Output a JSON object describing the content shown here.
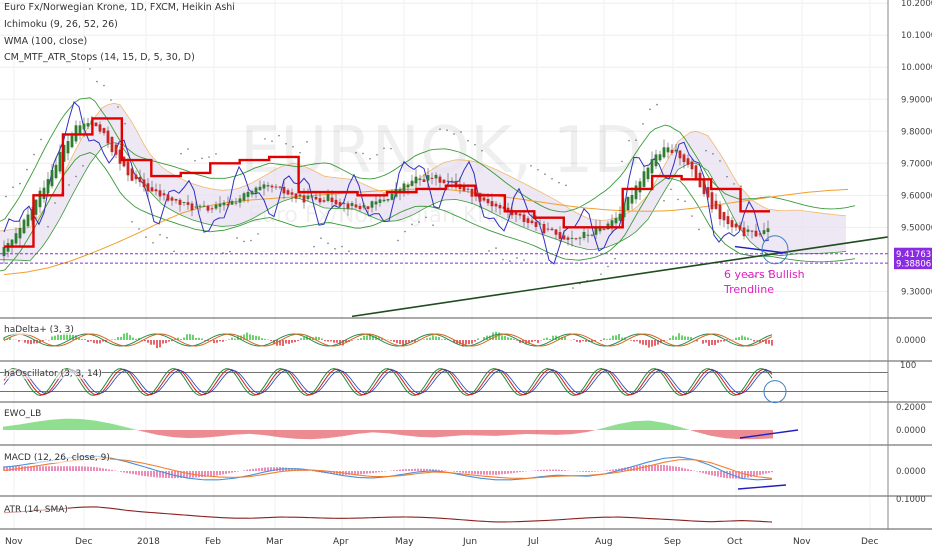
{
  "header": {
    "title": "Euro Fx/Norwegian Krone, 1D, FXCM, Heikin Ashi",
    "ichimoku": "Ichimoku (9, 26, 52, 26)",
    "wma": "WMA (100, close)",
    "atr_stops": "CM_MTF_ATR_Stops (14, 15, D, 5, 30, D)"
  },
  "watermark": {
    "symbol": "EURNOK, 1D",
    "subtitle": "Euro Fx/Norwegian Krone"
  },
  "annotation": {
    "line1": "6 years Bullish",
    "line2": "Trendline"
  },
  "x_axis": {
    "labels": [
      "Nov",
      "Dec",
      "2018",
      "Feb",
      "Mar",
      "Apr",
      "May",
      "Jun",
      "Jul",
      "Aug",
      "Sep",
      "Oct",
      "Nov",
      "Dec"
    ]
  },
  "colors": {
    "candle_up": "#2e7d32",
    "candle_down": "#c62828",
    "atr_stop": "#e00000",
    "wma": "#f0a030",
    "tenkan": "#3030c0",
    "cloud_line": "#3a9a3a",
    "kumo_fill": "#e8dff0",
    "trendline": "#1f4d1f",
    "support": "#8a2be2",
    "annotation": "#e020c0",
    "hist_up": "#46c846",
    "hist_down": "#e0404a",
    "macd_line": "#4a90d9",
    "signal_line": "#f08030"
  },
  "chart_data": [
    {
      "type": "candlestick",
      "title": "Euro Fx/Norwegian Krone, 1D, FXCM, Heikin Ashi",
      "ylim": [
        9.22,
        10.21
      ],
      "y_ticks": [
        "10.20000",
        "10.10000",
        "10.00000",
        "9.90000",
        "9.80000",
        "9.70000",
        "9.60000",
        "9.50000",
        "9.30000"
      ],
      "price_labels": [
        "9.41763",
        "9.38806"
      ],
      "months": [
        "Nov",
        "Dec",
        "2018",
        "Feb",
        "Mar",
        "Apr",
        "May",
        "Jun",
        "Jul",
        "Aug",
        "Sep",
        "Oct"
      ],
      "close": [
        9.41,
        9.56,
        9.76,
        9.87,
        9.67,
        9.61,
        9.57,
        9.55,
        9.59,
        9.64,
        9.58,
        9.6,
        9.55,
        9.59,
        9.66,
        9.65,
        9.6,
        9.55,
        9.51,
        9.46,
        9.48,
        9.54,
        9.74,
        9.75,
        9.55,
        9.47,
        9.49
      ],
      "atr_stop": [
        9.44,
        9.6,
        9.79,
        9.84,
        9.71,
        9.66,
        9.67,
        9.7,
        9.71,
        9.72,
        9.61,
        9.61,
        9.6,
        9.61,
        9.62,
        9.63,
        9.6,
        9.55,
        9.53,
        9.5,
        9.5,
        9.62,
        9.66,
        9.65,
        9.62,
        9.55
      ],
      "wma_100": [
        9.35,
        9.37,
        9.42,
        9.48,
        9.55,
        9.58,
        9.59,
        9.6,
        9.61,
        9.62,
        9.62,
        9.6,
        9.58,
        9.56,
        9.55,
        9.55,
        9.57,
        9.59,
        9.61,
        9.62
      ],
      "support_levels": [
        9.41763,
        9.38806
      ],
      "trendline": {
        "label": "6 years Bullish Trendline"
      }
    },
    {
      "type": "bar",
      "title": "haDelta+ (3, 3)",
      "y_ticks": [
        "0.0000"
      ],
      "values": [
        0.3,
        -0.5,
        0.8,
        -0.4,
        0.6,
        -0.7,
        0.5,
        -0.3,
        0.7,
        -0.6,
        0.4,
        -0.5,
        0.6,
        -0.4,
        0.5,
        -0.6,
        0.8,
        -0.5,
        0.4,
        -0.3,
        0.5,
        -0.7,
        0.6,
        -0.5,
        0.4,
        -0.6
      ]
    },
    {
      "type": "line",
      "title": "haOscillator (3, 3, 14)",
      "y_ticks": [
        "100"
      ],
      "ylim": [
        0,
        100
      ],
      "values": [
        60,
        20,
        85,
        30,
        70,
        15,
        80,
        40,
        90,
        25,
        65,
        10,
        75,
        35,
        85,
        20,
        60,
        30,
        80,
        15,
        70,
        45,
        90,
        25,
        55,
        20
      ]
    },
    {
      "type": "bar",
      "title": "EWO_LB",
      "y_ticks": [
        "0.2000",
        "0.0000"
      ],
      "values": [
        0.05,
        0.15,
        0.22,
        0.18,
        0.05,
        -0.1,
        -0.16,
        -0.12,
        -0.05,
        -0.14,
        -0.18,
        -0.12,
        -0.02,
        -0.1,
        -0.15,
        -0.08,
        -0.12,
        -0.06,
        -0.1,
        -0.05,
        0.12,
        0.2,
        0.06,
        -0.12,
        -0.18,
        -0.15
      ]
    },
    {
      "type": "line",
      "title": "MACD (12, 26, close, 9)",
      "y_ticks": [
        "0.0000"
      ],
      "macd": [
        0.02,
        0.05,
        0.08,
        0.1,
        0.06,
        0.0,
        -0.05,
        -0.06,
        -0.03,
        0.02,
        0.01,
        -0.03,
        -0.05,
        -0.02,
        0.01,
        -0.03,
        -0.06,
        -0.05,
        -0.02,
        -0.04,
        0.0,
        0.06,
        0.1,
        0.04,
        -0.06,
        -0.05
      ],
      "signal": [
        0.0,
        0.03,
        0.06,
        0.08,
        0.07,
        0.03,
        -0.02,
        -0.04,
        -0.04,
        0.0,
        0.01,
        -0.01,
        -0.04,
        -0.03,
        0.0,
        -0.02,
        -0.04,
        -0.05,
        -0.03,
        -0.03,
        -0.01,
        0.03,
        0.08,
        0.06,
        -0.02,
        -0.05
      ]
    },
    {
      "type": "line",
      "title": "ATR (14, SMA)",
      "y_ticks": [
        "0.1000"
      ],
      "values": [
        0.07,
        0.075,
        0.08,
        0.085,
        0.075,
        0.07,
        0.065,
        0.06,
        0.058,
        0.062,
        0.06,
        0.058,
        0.06,
        0.062,
        0.06,
        0.055,
        0.05,
        0.052,
        0.055,
        0.06,
        0.062,
        0.058,
        0.055,
        0.05,
        0.055,
        0.05
      ]
    }
  ]
}
